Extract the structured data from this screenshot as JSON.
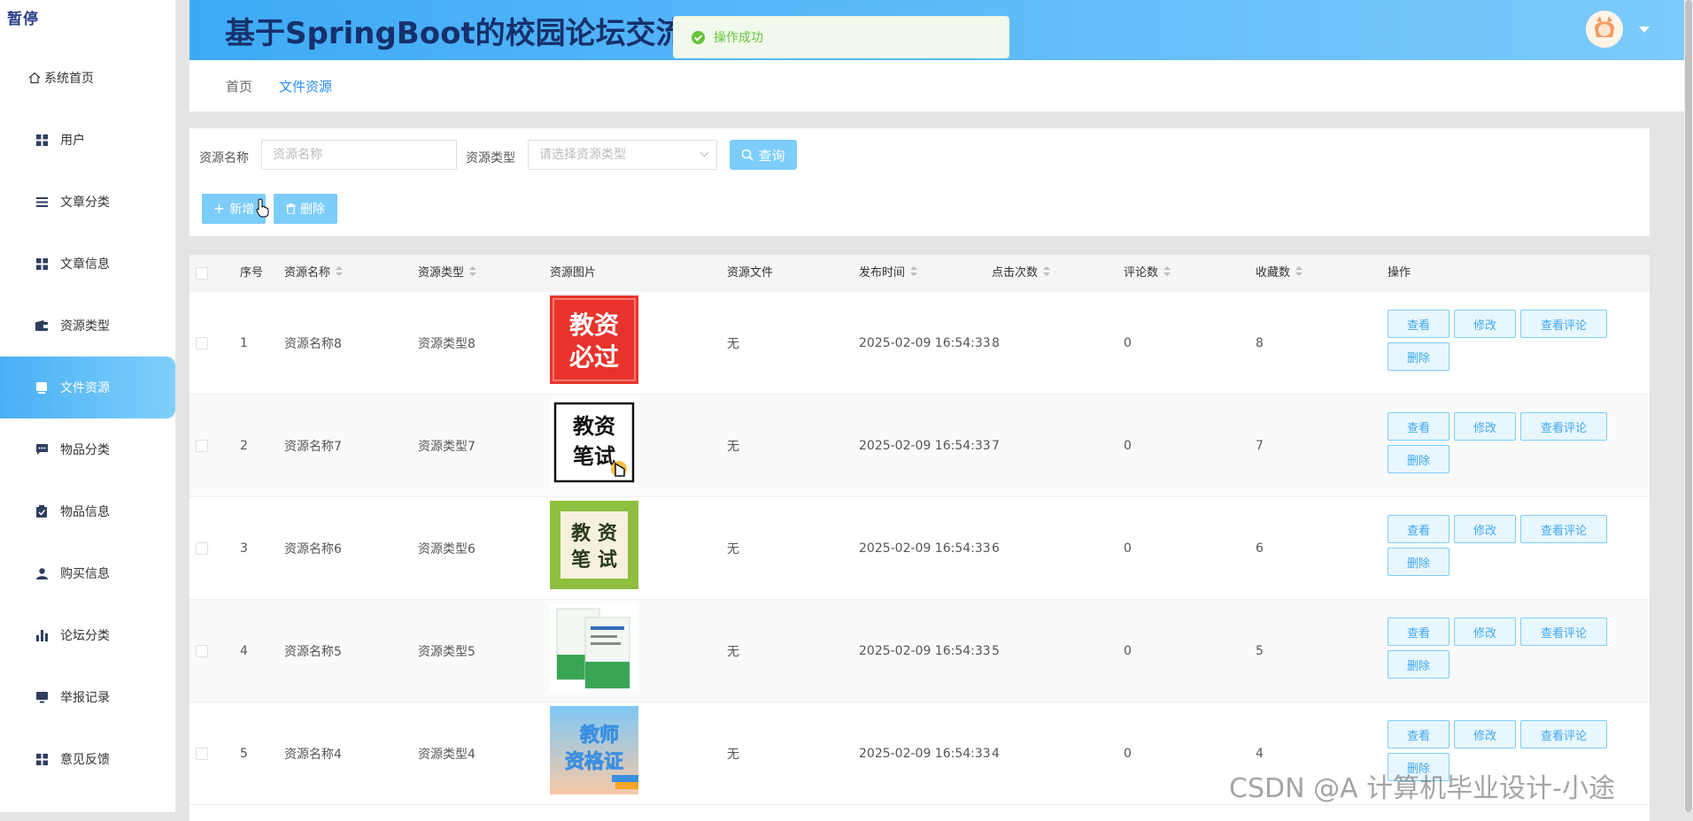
{
  "sidebar": {
    "logo": "暂停",
    "items": [
      {
        "label": "系统首页",
        "icon": "home-icon"
      },
      {
        "label": "用户",
        "icon": "grid-icon"
      },
      {
        "label": "文章分类",
        "icon": "list-icon"
      },
      {
        "label": "文章信息",
        "icon": "grid-icon"
      },
      {
        "label": "资源类型",
        "icon": "wallet-icon"
      },
      {
        "label": "文件资源",
        "icon": "file-icon",
        "active": true
      },
      {
        "label": "物品分类",
        "icon": "chat-icon"
      },
      {
        "label": "物品信息",
        "icon": "clipboard-icon"
      },
      {
        "label": "购买信息",
        "icon": "user-icon"
      },
      {
        "label": "论坛分类",
        "icon": "bar-chart-icon"
      },
      {
        "label": "举报记录",
        "icon": "monitor-icon"
      },
      {
        "label": "意见反馈",
        "icon": "grid-icon"
      }
    ]
  },
  "header": {
    "title": "基于SpringBoot的校园论坛交流系统",
    "accent": "#49aff5"
  },
  "toast": {
    "message": "操作成功"
  },
  "breadcrumb": {
    "home": "首页",
    "current": "文件资源"
  },
  "filter": {
    "name_label": "资源名称",
    "name_placeholder": "资源名称",
    "type_label": "资源类型",
    "type_placeholder": "请选择资源类型",
    "query_label": "查询",
    "add_label": "新增",
    "delete_label": "删除"
  },
  "table": {
    "headers": {
      "index": "序号",
      "name": "资源名称",
      "type": "资源类型",
      "image": "资源图片",
      "file": "资源文件",
      "time": "发布时间",
      "clicks": "点击次数",
      "comments": "评论数",
      "favorites": "收藏数",
      "actions": "操作"
    },
    "actions": {
      "view": "查看",
      "edit": "修改",
      "view_comments": "查看评论",
      "delete": "删除"
    },
    "rows": [
      {
        "index": "1",
        "name": "资源名称8",
        "type": "资源类型8",
        "image_text": "教资必过",
        "file": "无",
        "time": "2025-02-09 16:54:33",
        "clicks": "8",
        "comments": "0",
        "favorites": "8"
      },
      {
        "index": "2",
        "name": "资源名称7",
        "type": "资源类型7",
        "image_text": "教资笔试",
        "file": "无",
        "time": "2025-02-09 16:54:33",
        "clicks": "7",
        "comments": "0",
        "favorites": "7"
      },
      {
        "index": "3",
        "name": "资源名称6",
        "type": "资源类型6",
        "image_text": "教资笔试",
        "file": "无",
        "time": "2025-02-09 16:54:33",
        "clicks": "6",
        "comments": "0",
        "favorites": "6"
      },
      {
        "index": "4",
        "name": "资源名称5",
        "type": "资源类型5",
        "image_text": "",
        "file": "无",
        "time": "2025-02-09 16:54:33",
        "clicks": "5",
        "comments": "0",
        "favorites": "5"
      },
      {
        "index": "5",
        "name": "资源名称4",
        "type": "资源类型4",
        "image_text": "教师资格证",
        "file": "无",
        "time": "2025-02-09 16:54:33",
        "clicks": "4",
        "comments": "0",
        "favorites": "4"
      }
    ]
  },
  "watermark": "CSDN @A 计算机毕业设计-小途"
}
